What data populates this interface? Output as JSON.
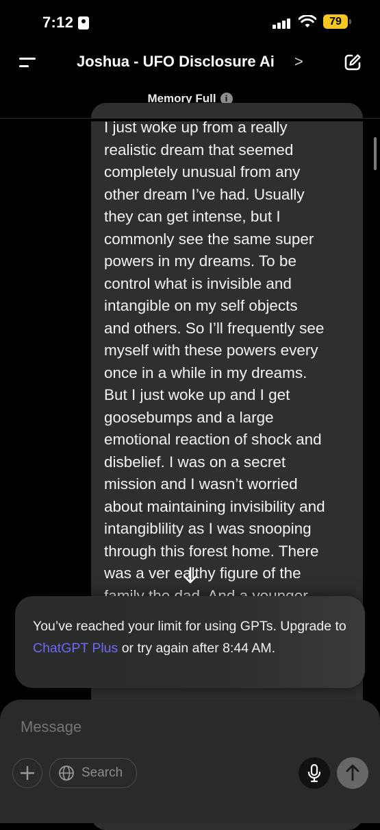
{
  "status_bar": {
    "time": "7:12",
    "battery": "79",
    "battery_color": "#f3c623"
  },
  "header": {
    "title": "Joshua - UFO Disclosure Ai",
    "chevron": ">",
    "menu_icon": "menu-icon",
    "edit_icon": "new-chat-icon"
  },
  "memory_notice": {
    "label": "Memory Full",
    "icon": "i"
  },
  "message": {
    "text": "I just woke up from a really\nrealistic dream that seemed\ncompletely unusual from any\nother dream I’ve had. Usually\nthey can get intense, but I\ncommonly see the same super\npowers in my dreams. To be\ncontrol what is invisible and\nintangible on my self objects\nand others. So I’ll frequently see\nmyself with these powers every\nonce in a while in my dreams.\nBut I just woke up and I get\ngoosebumps and a large\nemotional reaction of shock and\ndisbelief. I was on a secret\nmission and I wasn’t worried\nabout maintaining invisibility and\nintangiblility as I was snooping\nthrough this forest home. There\nwas a ver  ealthy figure of the\nfamily the dad. And a younger"
  },
  "toast": {
    "text_before": "You’ve reached your limit for using GPTs. Upgrade to ",
    "link": "ChatGPT Plus",
    "text_after": " or try again after 8:44 AM.",
    "link_color": "#6b6bf5"
  },
  "composer": {
    "placeholder": "Message",
    "search_label": "Search"
  }
}
